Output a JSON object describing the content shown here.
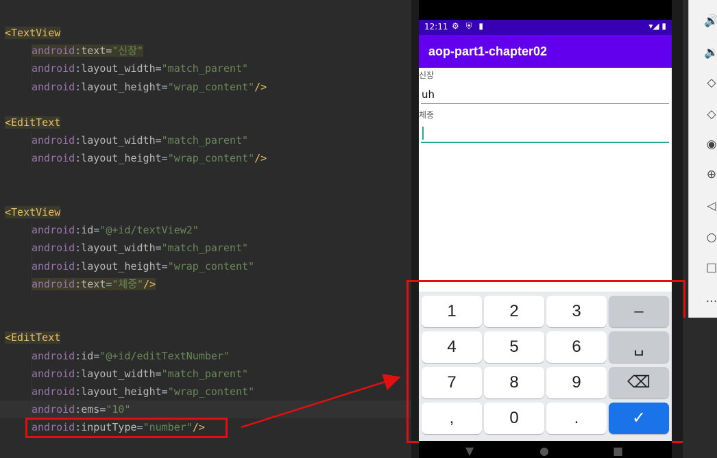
{
  "editor": {
    "lines": [
      {
        "kind": "open",
        "tag": "<TextView"
      },
      {
        "kind": "attr",
        "ns": "android",
        "name": "text",
        "value": "\"신장\"",
        "hl": true
      },
      {
        "kind": "attr",
        "ns": "android",
        "name": "layout_width",
        "value": "\"match_parent\""
      },
      {
        "kind": "attr",
        "ns": "android",
        "name": "layout_height",
        "value": "\"wrap_content\"",
        "close": "/>"
      },
      {
        "kind": "blank"
      },
      {
        "kind": "open",
        "tag": "<EditText"
      },
      {
        "kind": "attr",
        "ns": "android",
        "name": "layout_width",
        "value": "\"match_parent\""
      },
      {
        "kind": "attr",
        "ns": "android",
        "name": "layout_height",
        "value": "\"wrap_content\"",
        "close": "/>"
      },
      {
        "kind": "blank"
      },
      {
        "kind": "blank"
      },
      {
        "kind": "open",
        "tag": "<TextView"
      },
      {
        "kind": "attr",
        "ns": "android",
        "name": "id",
        "value": "\"@+id/textView2\""
      },
      {
        "kind": "attr",
        "ns": "android",
        "name": "layout_width",
        "value": "\"match_parent\""
      },
      {
        "kind": "attr",
        "ns": "android",
        "name": "layout_height",
        "value": "\"wrap_content\""
      },
      {
        "kind": "attr",
        "ns": "android",
        "name": "text",
        "value": "\"체중\"",
        "close": "/>",
        "hl": true
      },
      {
        "kind": "blank"
      },
      {
        "kind": "blank"
      },
      {
        "kind": "open",
        "tag": "<EditText"
      },
      {
        "kind": "attr",
        "ns": "android",
        "name": "id",
        "value": "\"@+id/editTextNumber\""
      },
      {
        "kind": "attr",
        "ns": "android",
        "name": "layout_width",
        "value": "\"match_parent\""
      },
      {
        "kind": "attr",
        "ns": "android",
        "name": "layout_height",
        "value": "\"wrap_content\""
      },
      {
        "kind": "attr",
        "ns": "android",
        "name": "ems",
        "value": "\"10\"",
        "caret": true
      },
      {
        "kind": "attr",
        "ns": "android",
        "name": "inputType",
        "value": "\"number\"",
        "close": "/>"
      }
    ]
  },
  "emulator": {
    "status": {
      "time": "12:11",
      "left_icons": "⚙ ⛨ ▮",
      "right_icons": "▾◢ ▮"
    },
    "app_title": "aop-part1-chapter02",
    "height_label": "신장",
    "height_value": "uh",
    "weight_label": "체중",
    "keyboard": {
      "rows": [
        [
          "1",
          "2",
          "3",
          "–"
        ],
        [
          "4",
          "5",
          "6",
          "␣"
        ],
        [
          "7",
          "8",
          "9",
          "⌫"
        ],
        [
          ",",
          "0",
          ".",
          "✓"
        ]
      ]
    },
    "nav": {
      "back": "▼",
      "home": "●",
      "recents": "■"
    }
  },
  "side_toolbar": {
    "buttons": [
      "volume-up",
      "volume-down",
      "rotate-left",
      "rotate-right",
      "screenshot",
      "zoom",
      "back",
      "home",
      "overview",
      "more"
    ],
    "glyphs": [
      "🔊",
      "🔉",
      "◇",
      "◇",
      "◉",
      "⊕",
      "◁",
      "○",
      "□",
      "…"
    ]
  },
  "colors": {
    "app_bar": "#6200ee",
    "status_bar": "#3700b3",
    "accent": "#26a69a",
    "key_action": "#1a73e8",
    "callout": "#e01010"
  }
}
